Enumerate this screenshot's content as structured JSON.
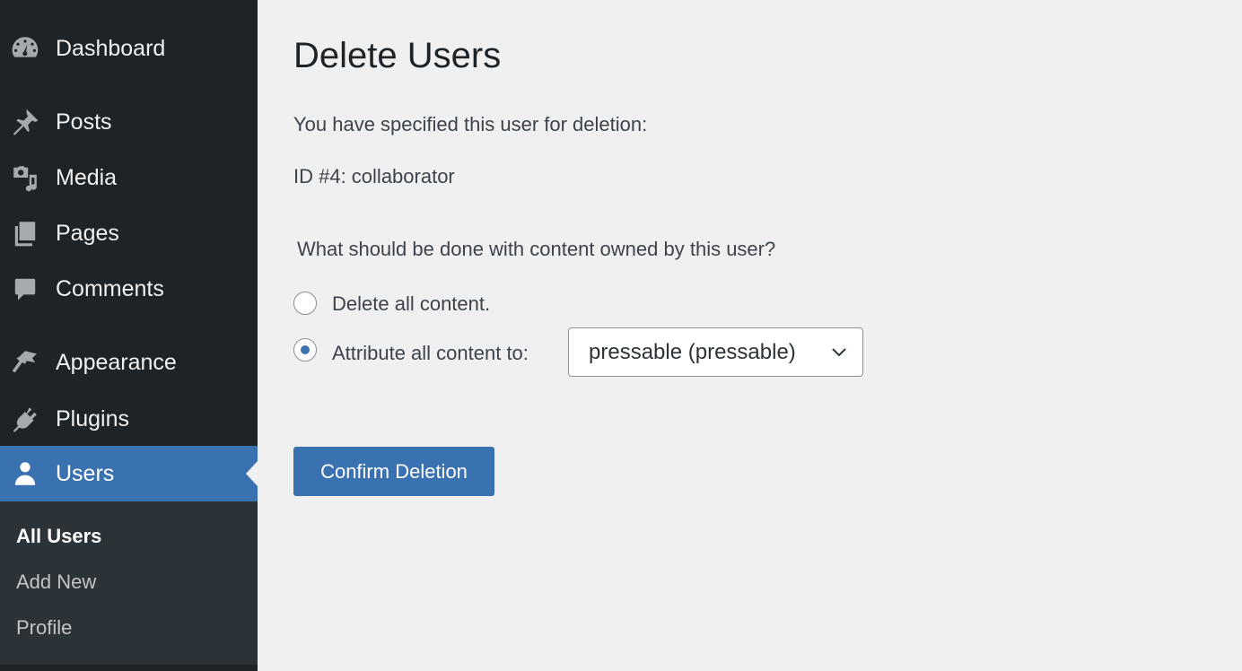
{
  "sidebar": {
    "items": [
      {
        "label": "Dashboard",
        "icon": "dashboard-icon"
      },
      {
        "label": "Posts",
        "icon": "pin-icon"
      },
      {
        "label": "Media",
        "icon": "media-icon"
      },
      {
        "label": "Pages",
        "icon": "pages-icon"
      },
      {
        "label": "Comments",
        "icon": "comment-icon"
      },
      {
        "label": "Appearance",
        "icon": "paintbrush-icon"
      },
      {
        "label": "Plugins",
        "icon": "plug-icon"
      },
      {
        "label": "Users",
        "icon": "user-icon",
        "active": true
      }
    ],
    "submenu": [
      {
        "label": "All Users",
        "current": true
      },
      {
        "label": "Add New"
      },
      {
        "label": "Profile"
      }
    ]
  },
  "main": {
    "title": "Delete Users",
    "intro": "You have specified this user for deletion:",
    "user": "ID #4: collaborator",
    "question": "What should be done with content owned by this user?",
    "option_delete": "Delete all content.",
    "option_attribute": "Attribute all content to:",
    "selected_option": "attribute",
    "attribute_select_value": "pressable (pressable)",
    "confirm_button": "Confirm Deletion"
  },
  "colors": {
    "accent": "#3a72b1",
    "sidebar_bg": "#1d2327",
    "submenu_bg": "#2c3338",
    "page_bg": "#f0f0f1"
  }
}
